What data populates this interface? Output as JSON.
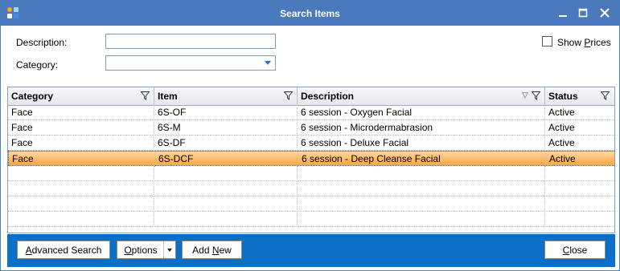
{
  "window": {
    "title": "Search Items",
    "title_bar_color": "#4a79bd",
    "buttons": [
      "minimize-icon",
      "maximize-icon",
      "close-icon"
    ]
  },
  "filters": {
    "description_label": "Description:",
    "description_value": "",
    "category_label": "Category:",
    "category_value": "",
    "show_prices_label_pre": "Show ",
    "show_prices_label_accel": "P",
    "show_prices_label_post": "rices",
    "show_prices_checked": false
  },
  "grid": {
    "columns": [
      "Category",
      "Item",
      "Description",
      "Status"
    ],
    "rows": [
      [
        "Face",
        "6S-OF",
        "6 session - Oxygen Facial",
        "Active"
      ],
      [
        "Face",
        "6S-M",
        "6 session - Microdermabrasion",
        "Active"
      ],
      [
        "Face",
        "6S-DF",
        "6 session - Deluxe Facial",
        "Active"
      ],
      [
        "Face",
        "6S-DCF",
        "6 session - Deep Cleanse Facial",
        "Active"
      ]
    ],
    "selected_row": 3,
    "selected_color": "#ffba66"
  },
  "footer": {
    "bar_color": "#0b6fc8",
    "advanced_pre": "",
    "advanced_accel": "A",
    "advanced_post": "dvanced Search",
    "options_pre": "",
    "options_accel": "O",
    "options_post": "ptions",
    "add_new_pre": "Add ",
    "add_new_accel": "N",
    "add_new_post": "ew",
    "close_pre": "",
    "close_accel": "C",
    "close_post": "lose"
  }
}
